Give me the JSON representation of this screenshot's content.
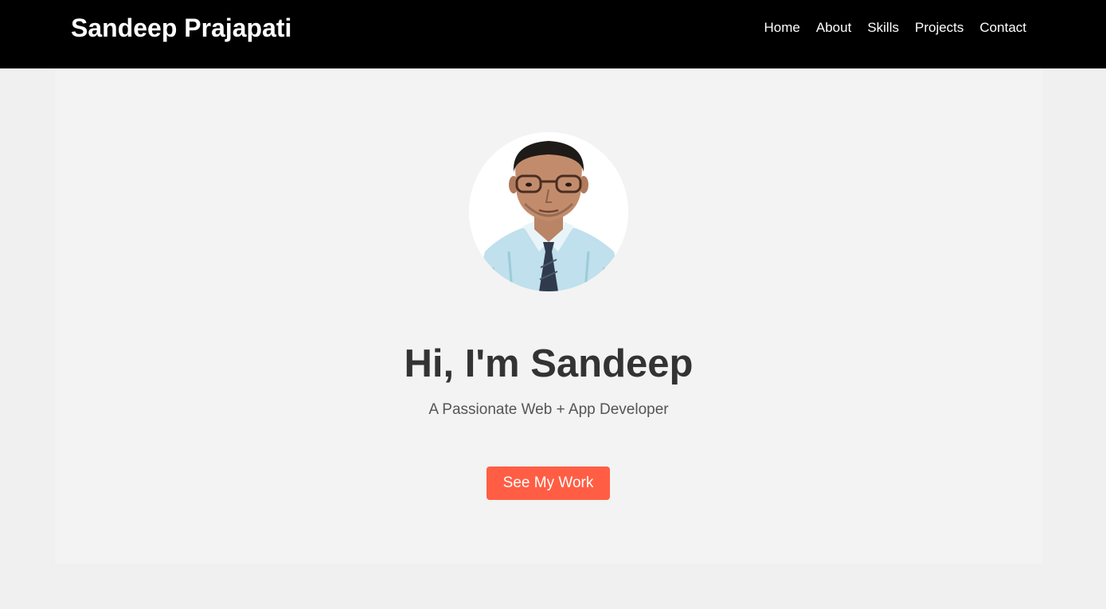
{
  "nav": {
    "brand": "Sandeep Prajapati",
    "links": [
      {
        "label": "Home"
      },
      {
        "label": "About"
      },
      {
        "label": "Skills"
      },
      {
        "label": "Projects"
      },
      {
        "label": "Contact"
      }
    ]
  },
  "hero": {
    "title": "Hi, I'm Sandeep",
    "subtitle": "A Passionate Web + App Developer",
    "cta_label": "See My Work"
  },
  "colors": {
    "navbar_bg": "#000000",
    "page_bg": "#f0f0f0",
    "hero_bg": "#f3f3f3",
    "accent": "#ff5e44",
    "heading": "#333333",
    "subtext": "#555555"
  }
}
